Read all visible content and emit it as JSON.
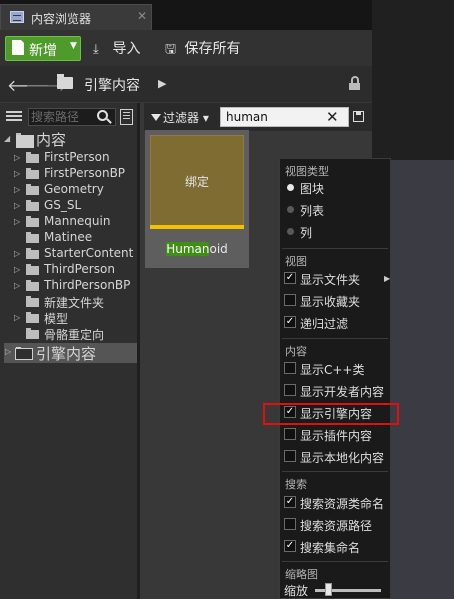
{
  "window": {
    "tab_title": "内容浏览器",
    "tab_icon": "content-browser-icon"
  },
  "toolbar": {
    "new_label": "新增",
    "import_label": "导入",
    "save_all_label": "保存所有"
  },
  "path_bar": {
    "current": "引擎内容"
  },
  "tree": {
    "search_placeholder": "搜索路径",
    "root": "内容",
    "items": [
      {
        "label": "FirstPerson",
        "expandable": true
      },
      {
        "label": "FirstPersonBP",
        "expandable": true
      },
      {
        "label": "Geometry",
        "expandable": true
      },
      {
        "label": "GS_SL",
        "expandable": true
      },
      {
        "label": "Mannequin",
        "expandable": true
      },
      {
        "label": "Matinee",
        "expandable": false
      },
      {
        "label": "StarterContent",
        "expandable": true
      },
      {
        "label": "ThirdPerson",
        "expandable": true
      },
      {
        "label": "ThirdPersonBP",
        "expandable": true
      },
      {
        "label": "新建文件夹",
        "expandable": false
      },
      {
        "label": "模型",
        "expandable": true
      },
      {
        "label": "骨骼重定向",
        "expandable": false
      }
    ],
    "engine_content": "引擎内容"
  },
  "filter": {
    "filters_label": "过滤器",
    "search_value": "human"
  },
  "asset": {
    "thumb_label": "绑定",
    "name_match": "Human",
    "name_rest": "oid",
    "bar_color": "#f2c200"
  },
  "menu": {
    "view_type_heading": "视图类型",
    "tiles": "图块",
    "list": "列表",
    "columns": "列",
    "view_heading": "视图",
    "show_folders": "显示文件夹",
    "show_favorites": "显示收藏夹",
    "recursive_filter": "递归过滤",
    "content_heading": "内容",
    "show_cpp": "显示C++类",
    "show_dev": "显示开发者内容",
    "show_engine": "显示引擎内容",
    "show_plugin": "显示插件内容",
    "show_localized": "显示本地化内容",
    "search_heading": "搜索",
    "search_class_names": "搜索资源类命名",
    "search_asset_path": "搜索资源路径",
    "search_collection_names": "搜索集命名",
    "thumbnail_heading": "缩略图",
    "zoom_label": "缩放",
    "zoom_level": 0.2,
    "highlight_color": "#e01010"
  },
  "check_mark": "✓"
}
